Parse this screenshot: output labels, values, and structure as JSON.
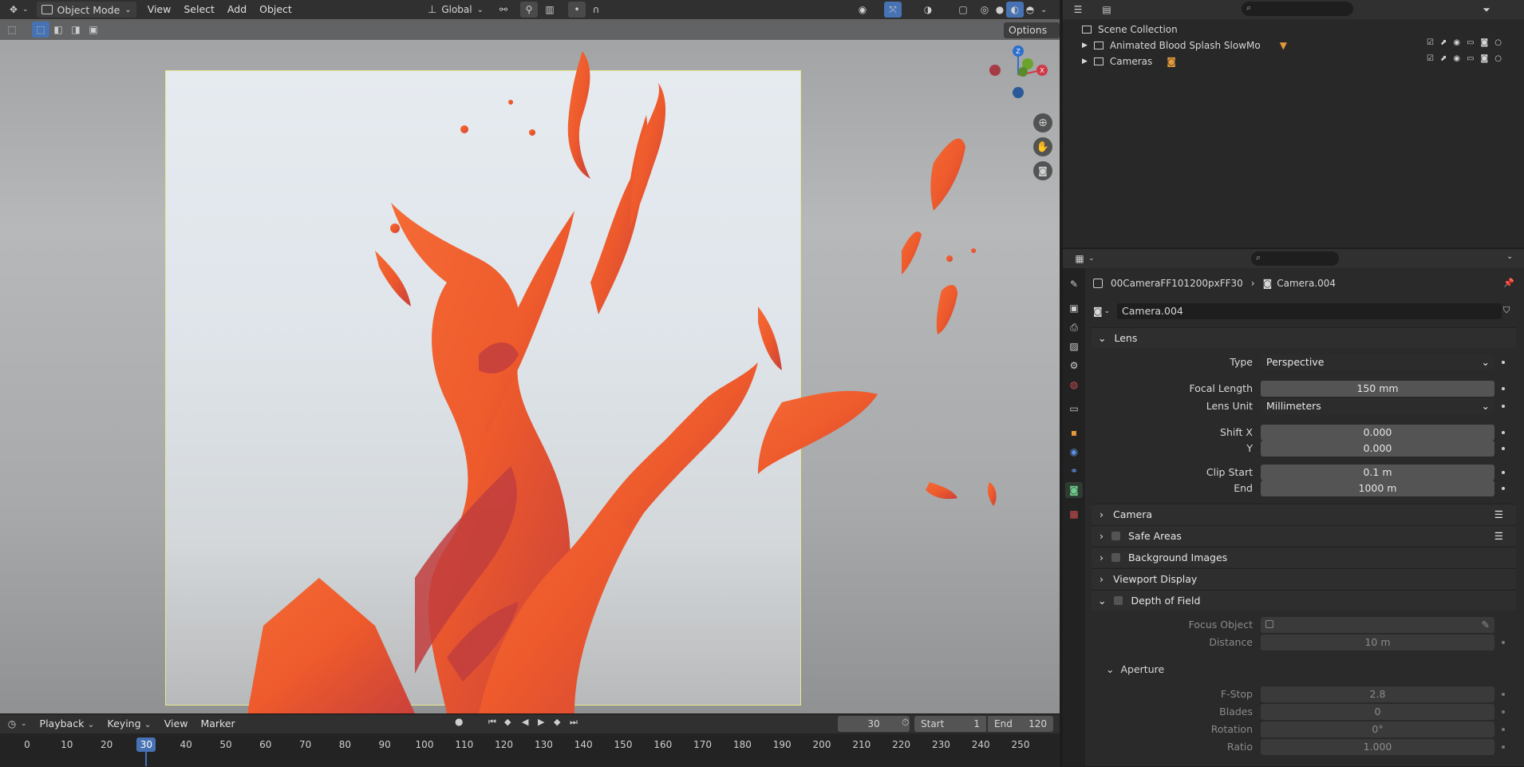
{
  "header": {
    "mode": "Object Mode",
    "menus": [
      "View",
      "Select",
      "Add",
      "Object"
    ],
    "transform_orientation": "Global",
    "options_label": "Options"
  },
  "outliner": {
    "root": "Scene Collection",
    "items": [
      {
        "label": "Animated Blood Splash SlowMo"
      },
      {
        "label": "Cameras"
      }
    ]
  },
  "properties": {
    "breadcrumb_object": "00CameraFF101200pxFF30",
    "breadcrumb_data": "Camera.004",
    "datablock_name": "Camera.004",
    "lens": {
      "title": "Lens",
      "type_label": "Type",
      "type_value": "Perspective",
      "focal_label": "Focal Length",
      "focal_value": "150 mm",
      "unit_label": "Lens Unit",
      "unit_value": "Millimeters",
      "shiftx_label": "Shift X",
      "shiftx_value": "0.000",
      "shifty_label": "Y",
      "shifty_value": "0.000",
      "clipstart_label": "Clip Start",
      "clipstart_value": "0.1 m",
      "clipend_label": "End",
      "clipend_value": "1000 m"
    },
    "panels": {
      "camera": "Camera",
      "safe_areas": "Safe Areas",
      "background_images": "Background Images",
      "viewport_display": "Viewport Display",
      "dof": "Depth of Field"
    },
    "dof": {
      "focus_object_label": "Focus Object",
      "distance_label": "Distance",
      "distance_value": "10 m",
      "aperture_title": "Aperture",
      "fstop_label": "F-Stop",
      "fstop_value": "2.8",
      "blades_label": "Blades",
      "blades_value": "0",
      "rotation_label": "Rotation",
      "rotation_value": "0°",
      "ratio_label": "Ratio",
      "ratio_value": "1.000"
    }
  },
  "timeline": {
    "menus": [
      "Playback",
      "Keying",
      "View",
      "Marker"
    ],
    "current_frame": "30",
    "start_label": "Start",
    "start_value": "1",
    "end_label": "End",
    "end_value": "120",
    "ticks": [
      "0",
      "10",
      "20",
      "30",
      "40",
      "50",
      "60",
      "70",
      "80",
      "90",
      "100",
      "110",
      "120",
      "130",
      "140",
      "150",
      "160",
      "170",
      "180",
      "190",
      "200",
      "210",
      "220",
      "230",
      "240",
      "250"
    ]
  },
  "colors": {
    "accent": "#4772b3",
    "splash": "#f0562a",
    "splash_dark": "#c43a2a"
  }
}
